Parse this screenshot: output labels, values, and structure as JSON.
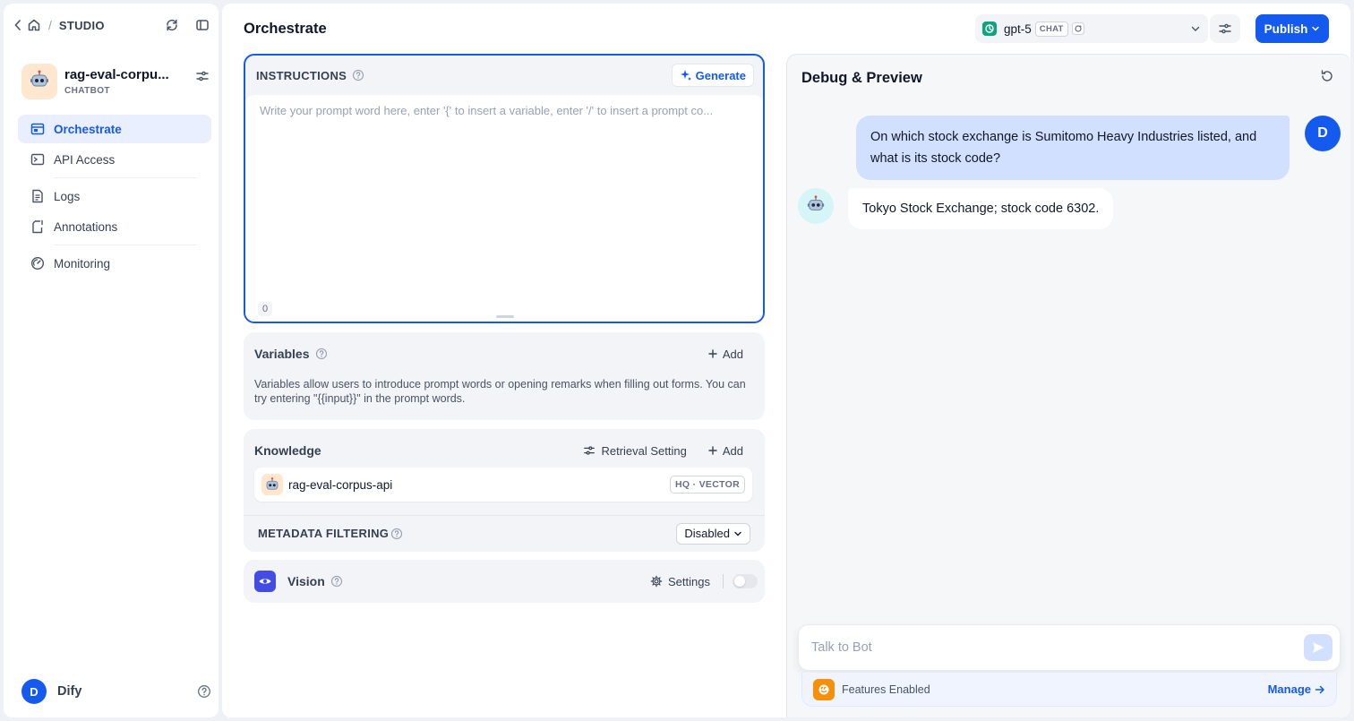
{
  "sidebar": {
    "breadcrumb": "STUDIO",
    "app": {
      "name": "rag-eval-corpu...",
      "type": "CHATBOT"
    },
    "nav": [
      {
        "label": "Orchestrate",
        "active": true
      },
      {
        "label": "API Access"
      },
      {
        "label": "Logs"
      },
      {
        "label": "Annotations"
      },
      {
        "label": "Monitoring"
      }
    ],
    "user": {
      "initial": "D",
      "workspace": "Dify"
    }
  },
  "header": {
    "title": "Orchestrate",
    "model": {
      "name": "gpt-5",
      "mode": "CHAT"
    },
    "publish_label": "Publish"
  },
  "instructions": {
    "label": "INSTRUCTIONS",
    "generate_label": "Generate",
    "placeholder": "Write your prompt word here, enter '{' to insert a variable, enter '/' to insert a prompt co...",
    "value": "",
    "char_count": "0"
  },
  "variables": {
    "title": "Variables",
    "add_label": "Add",
    "description": "Variables allow users to introduce prompt words or opening remarks when filling out forms. You can try entering \"{{input}}\" in the prompt words."
  },
  "knowledge": {
    "title": "Knowledge",
    "retrieval_label": "Retrieval Setting",
    "add_label": "Add",
    "items": [
      {
        "name": "rag-eval-corpus-api",
        "badge": "HQ · VECTOR"
      }
    ],
    "metadata_label": "METADATA FILTERING",
    "metadata_value": "Disabled"
  },
  "vision": {
    "title": "Vision",
    "settings_label": "Settings",
    "enabled": false
  },
  "debug": {
    "title": "Debug & Preview",
    "messages": [
      {
        "role": "user",
        "avatar": "D",
        "text": "On which stock exchange is Sumitomo Heavy Industries listed, and what is its stock code?"
      },
      {
        "role": "bot",
        "text": "Tokyo Stock Exchange; stock code 6302."
      }
    ],
    "input_placeholder": "Talk to Bot",
    "features_label": "Features Enabled",
    "manage_label": "Manage"
  },
  "colors": {
    "accent": "#155aef",
    "vision": "#444ce7",
    "features": "#f79009"
  }
}
